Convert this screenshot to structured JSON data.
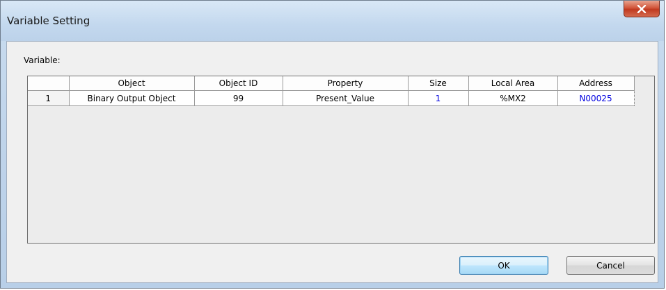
{
  "window": {
    "title": "Variable Setting"
  },
  "variable_label": "Variable:",
  "table": {
    "columns": [
      "",
      "Object",
      "Object ID",
      "Property",
      "Size",
      "Local Area",
      "Address"
    ],
    "rows": [
      {
        "index": "1",
        "object": "Binary Output Object",
        "object_id": "99",
        "property": "Present_Value",
        "size": "1",
        "local_area": "%MX2",
        "address": "N00025"
      }
    ]
  },
  "buttons": {
    "ok": "OK",
    "cancel": "Cancel"
  },
  "colors": {
    "link_blue": "#0000e0",
    "close_red": "#c03a20"
  },
  "icons": {
    "close": "close-icon"
  }
}
